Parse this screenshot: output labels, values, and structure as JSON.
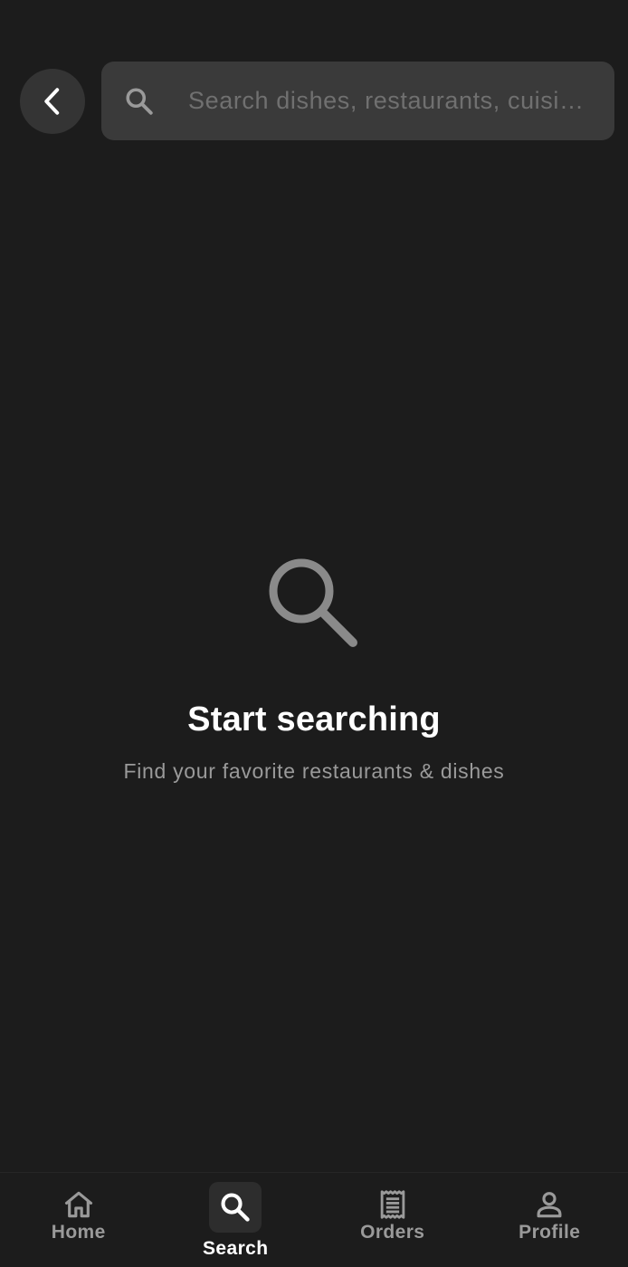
{
  "search": {
    "placeholder": "Search dishes, restaurants, cuisines...",
    "value": ""
  },
  "empty_state": {
    "icon": "search-icon",
    "title": "Start searching",
    "subtitle": "Find your favorite restaurants & dishes"
  },
  "bottom_nav": {
    "items": [
      {
        "label": "Home",
        "icon": "home-icon",
        "active": false
      },
      {
        "label": "Search",
        "icon": "search-icon",
        "active": true
      },
      {
        "label": "Orders",
        "icon": "receipt-icon",
        "active": false
      },
      {
        "label": "Profile",
        "icon": "person-icon",
        "active": false
      }
    ]
  },
  "colors": {
    "background": "#1c1c1c",
    "surface": "#3a3a3a",
    "back_button": "#343434",
    "text_primary": "#ffffff",
    "text_secondary": "#9a9a9a",
    "placeholder": "#707070",
    "icon_muted": "#8a8a8a"
  }
}
